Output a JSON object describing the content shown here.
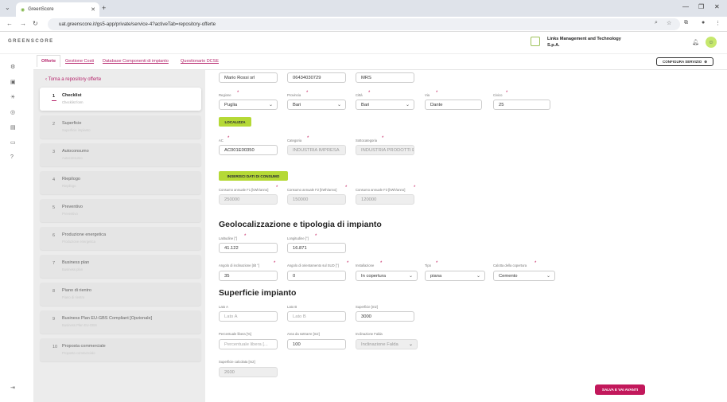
{
  "browser": {
    "tab_title": "GreenScore",
    "url": "uat.greenscore.it/gs5-app/private/service-4?activeTab=repository-offerte"
  },
  "header": {
    "logo_text": "GREENSCORE",
    "company_line1": "Links Management and Technology",
    "company_line2": "S.p.A."
  },
  "page_tabs": [
    {
      "label": "Offerte"
    },
    {
      "label": "Gestione Costi"
    },
    {
      "label": "Database Componenti di impianto"
    },
    {
      "label": "Questionario DCSE"
    }
  ],
  "config_button": "CONFIGURA SERVIZIO",
  "sidebar": {
    "back_label": "Torna a repository offerte",
    "steps": [
      {
        "num": "1",
        "title": "Checklist",
        "sub": "Checklist form"
      },
      {
        "num": "2",
        "title": "Superficie",
        "sub": "Superficie impianto"
      },
      {
        "num": "3",
        "title": "Autoconsumo",
        "sub": "Autoconsumo"
      },
      {
        "num": "4",
        "title": "Riepilogo",
        "sub": "Riepilogo"
      },
      {
        "num": "5",
        "title": "Preventivo",
        "sub": "Preventivo"
      },
      {
        "num": "6",
        "title": "Produzione energetica",
        "sub": "Produzione energetica"
      },
      {
        "num": "7",
        "title": "Business plan",
        "sub": "Business plan"
      },
      {
        "num": "8",
        "title": "Piano di rientro",
        "sub": "Piano di rientro"
      },
      {
        "num": "9",
        "title": "Business Plan EU-GBS Compliant [Opzionale]",
        "sub": "Business Plan EU-GBS"
      },
      {
        "num": "10",
        "title": "Proposta commerciale",
        "sub": "Proposta commerciale"
      }
    ]
  },
  "form": {
    "row0": {
      "nome": "Mario Rossi srl",
      "telefono": "06434030729",
      "codice": "MRS"
    },
    "labels": {
      "regione": "Regione",
      "provincia": "Provincia",
      "citta": "Città",
      "via": "Via",
      "civico": "Civico",
      "ac": "AC",
      "categoria": "Categoria",
      "sottocategoria": "Sottocategoria",
      "f1": "Consumo annuale F1 [kWh/anno]",
      "f2": "Consumo annuale F2 [kWh/anno]",
      "f3": "Consumo annuale F3 [kWh/anno]",
      "lat": "Latitudine [°]",
      "lon": "Longitudine [°]",
      "inclinazione": "Angolo di inclinazione [tilt °]",
      "orientamento": "Angolo di orientamento sul SUD [°]",
      "installazione": "Installazione",
      "tipo": "Tipo",
      "copertura": "Calotta della copertura",
      "latoa": "Lato A",
      "latob": "Lato B",
      "superficie": "Superficie [m2]",
      "perc": "Percentuale libera [%]",
      "area": "Area da sottrarre [m2]",
      "falda": "Inclinazione Falda",
      "sup_calc": "Superficie calcolata [m2]"
    },
    "values": {
      "regione": "Puglia",
      "provincia": "Bari",
      "citta": "Bari",
      "via": "Dante",
      "civico": "25",
      "ac": "AC001E00350",
      "categoria": "INDUSTRIA IMPRESA",
      "sottocategoria": "INDUSTRIA PRODOTTI E",
      "f1": "250000",
      "f2": "150000",
      "f3": "120000",
      "lat": "41.122",
      "lon": "16.871",
      "inclinazione": "35",
      "orientamento": "0",
      "installazione": "In copertura",
      "tipo": "piana",
      "copertura": "Cemento",
      "superficie": "3000",
      "area": "100",
      "sup_calc": "2600"
    },
    "placeholders": {
      "latoa": "Lato A",
      "latob": "Lato B",
      "perc": "Percentuale libera [...",
      "falda": "Inclinazione Falda"
    },
    "buttons": {
      "localizza": "LOCALIZZA",
      "inserisci": "INSERISCI DATI DI CONSUMO"
    },
    "headings": {
      "geo": "Geolocalizzazione e tipologia di impianto",
      "sup": "Superficie impianto"
    }
  },
  "save_button": "SALVA E VAI AVANTI",
  "colors": {
    "accent": "#b5246b",
    "green": "#b5d936"
  }
}
